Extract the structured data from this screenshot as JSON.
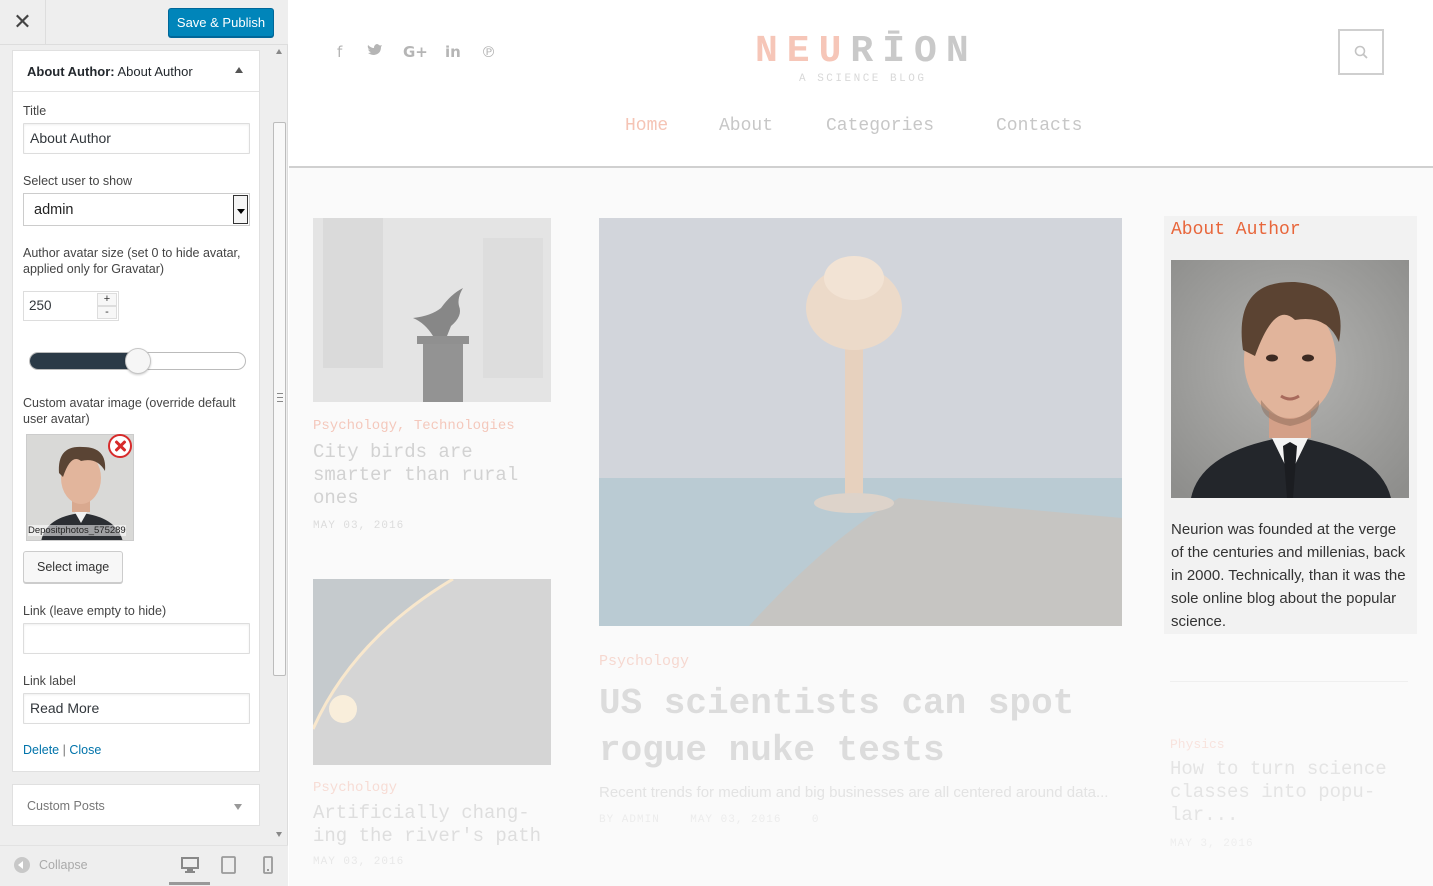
{
  "customizer": {
    "close_icon": "close-icon",
    "publish_label": "Save & Publish",
    "section": {
      "title_strong": "About Author:",
      "title_rest": " About Author"
    },
    "fields": {
      "title_label": "Title",
      "title_value": "About Author",
      "user_label": "Select user to show",
      "user_value": "admin",
      "avatar_size_label": "Author avatar size (set 0 to hide avatar, applied only for Gravatar)",
      "avatar_size_value": "250",
      "spin_up": "+",
      "spin_down": "-",
      "avatar_size_slider_fraction": 0.5,
      "custom_avatar_label": "Custom avatar image (override default user avatar)",
      "thumb_caption": "Depositphotos_575289",
      "select_image_label": "Select image",
      "link_label": "Link (leave empty to hide)",
      "link_value": "",
      "link_text_label": "Link label",
      "link_text_value": "Read More"
    },
    "actions": {
      "delete": "Delete",
      "separator": " | ",
      "close": "Close"
    },
    "next_section": "Custom Posts",
    "footer": {
      "collapse": "Collapse"
    }
  },
  "preview": {
    "logo": {
      "part1": "NEU",
      "part2": "RĪON",
      "tagline": "A SCIENCE BLOG"
    },
    "social_icons": [
      "f",
      "🐦",
      "G+",
      "in",
      "℗"
    ],
    "nav": [
      "Home",
      "About",
      "Categories",
      "Contacts"
    ],
    "posts": {
      "left1": {
        "category": "Psychology, Technologies",
        "title": "City birds are smarter than rural ones",
        "date": "MAY 03, 2016"
      },
      "left2": {
        "category": "Psychology",
        "title": "Artificially chang-ing the river's path",
        "date": "MAY 03, 2016"
      },
      "featured": {
        "category": "Psychology",
        "title": "US scientists can spot rogue nuke tests",
        "excerpt": "Recent trends for medium and big businesses are all centered around data...",
        "meta": "BY ADMIN    MAY 03, 2016    0"
      },
      "right": {
        "category": "Physics",
        "title": "How to turn science classes into popu-lar...",
        "date": "MAY 3, 2016"
      }
    },
    "widget": {
      "title": "About Author",
      "text": "Neurion was founded at the verge of the centuries and millenias, back in 2000. Technically, than it was the sole online blog about the popular science."
    }
  }
}
